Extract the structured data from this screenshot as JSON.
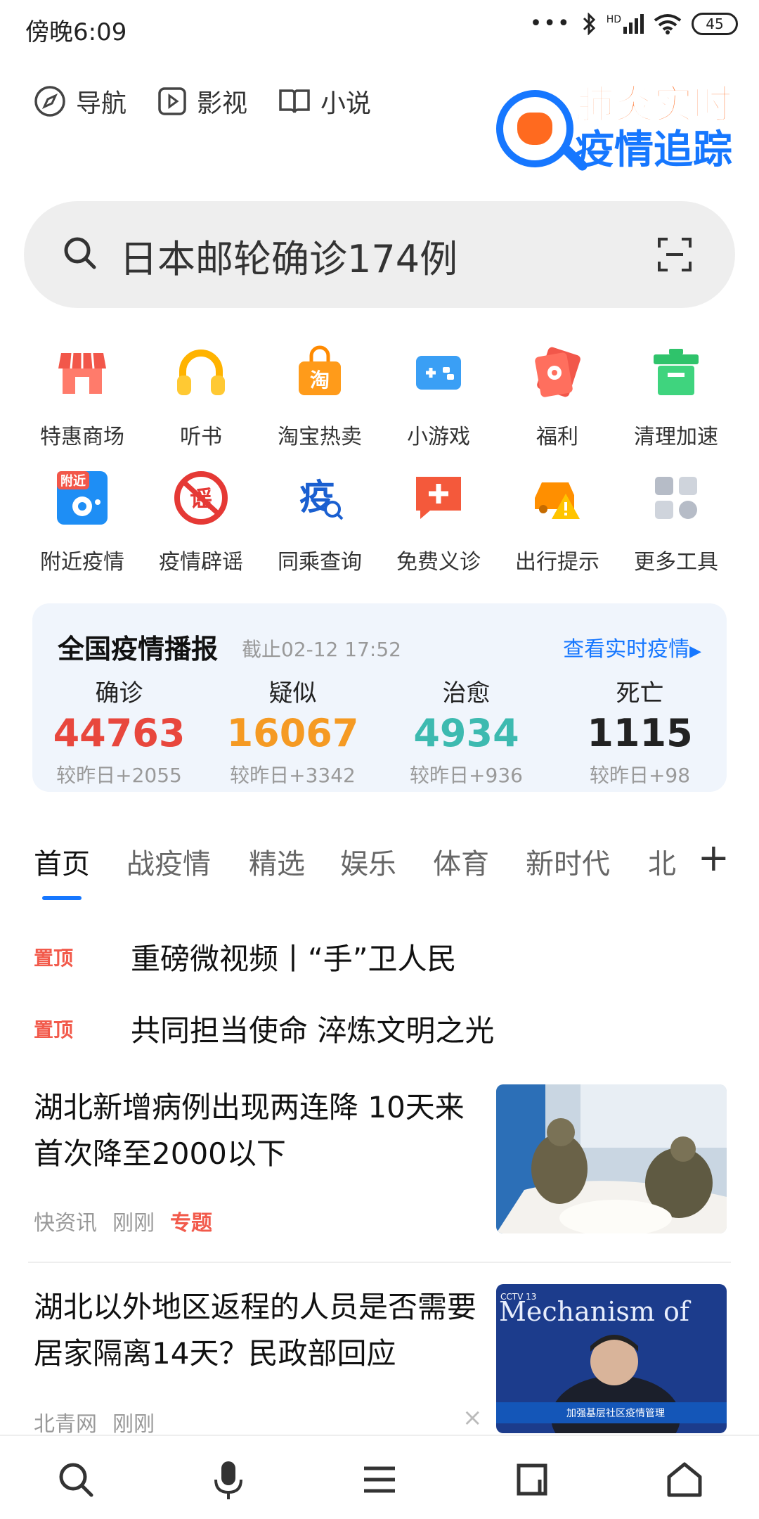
{
  "status": {
    "time": "傍晚6:09",
    "signal": "HD",
    "battery": "45"
  },
  "topnav": [
    {
      "icon": "compass-icon",
      "label": "导航"
    },
    {
      "icon": "video-icon",
      "label": "影视"
    },
    {
      "icon": "book-icon",
      "label": "小说"
    }
  ],
  "logo": {
    "line1": "肺炎实时",
    "line2": "疫情追踪"
  },
  "search": {
    "text": "日本邮轮确诊174例"
  },
  "grid": [
    {
      "label": "特惠商场",
      "icon": "shop-icon",
      "color": "#f2574a"
    },
    {
      "label": "听书",
      "icon": "headphones-icon",
      "color": "#ffb300"
    },
    {
      "label": "淘宝热卖",
      "icon": "taobao-bag-icon",
      "color": "#ff8a00"
    },
    {
      "label": "小游戏",
      "icon": "gamepad-icon",
      "color": "#3a9ff5"
    },
    {
      "label": "福利",
      "icon": "red-packet-icon",
      "color": "#f2574a"
    },
    {
      "label": "清理加速",
      "icon": "trash-icon",
      "color": "#2fc36b"
    },
    {
      "label": "附近疫情",
      "icon": "nearby-virus-icon",
      "color": "#1e8ef5",
      "badge": "附近"
    },
    {
      "label": "疫情辟谣",
      "icon": "rumor-ban-icon",
      "color": "#e53935",
      "badge": "谣"
    },
    {
      "label": "同乘查询",
      "icon": "epidemic-search-icon",
      "color": "#1a5fd0",
      "badge": "疫"
    },
    {
      "label": "免费义诊",
      "icon": "medical-chat-icon",
      "color": "#f4593b"
    },
    {
      "label": "出行提示",
      "icon": "car-warning-icon",
      "color": "#ff8f00"
    },
    {
      "label": "更多工具",
      "icon": "more-tools-icon",
      "color": "#b6bcc7"
    }
  ],
  "card": {
    "title": "全国疫情播报",
    "stamp": "截止02-12 17:52",
    "more": "查看实时疫情",
    "stats": [
      {
        "name": "确诊",
        "num": "44763",
        "delta": "较昨日+2055",
        "color": "#e8473d"
      },
      {
        "name": "疑似",
        "num": "16067",
        "delta": "较昨日+3342",
        "color": "#f59a23"
      },
      {
        "name": "治愈",
        "num": "4934",
        "delta": "较昨日+936",
        "color": "#3dbab0"
      },
      {
        "name": "死亡",
        "num": "1115",
        "delta": "较昨日+98",
        "color": "#222222"
      }
    ]
  },
  "tabs": [
    "首页",
    "战疫情",
    "精选",
    "娱乐",
    "体育",
    "新时代",
    "北"
  ],
  "pinned": [
    {
      "tag": "置顶",
      "title": "重磅微视频丨“手”卫人民"
    },
    {
      "tag": "置顶",
      "title": "共同担当使命 淬炼文明之光"
    }
  ],
  "news": [
    {
      "title": "湖北新增病例出现两连降 10天来首次降至2000以下",
      "source": "快资讯",
      "time": "刚刚",
      "tag": "专题"
    },
    {
      "title": "湖北以外地区返程的人员是否需要居家隔离14天？民政部回应",
      "source": "北青网",
      "time": "刚刚",
      "tag": ""
    }
  ],
  "thumb2": {
    "banner_top": "Mechanism of",
    "caption": "加强基层社区疫情管理",
    "channel": "CCTV 13"
  }
}
